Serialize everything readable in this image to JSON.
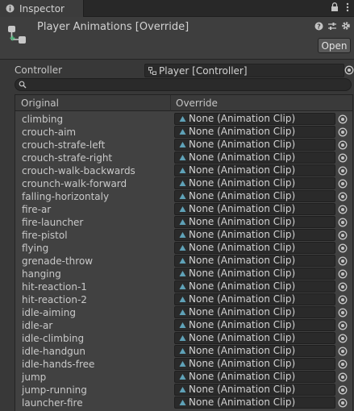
{
  "window": {
    "tab_label": "Inspector",
    "tab_icon": "info-icon",
    "tab_actions": [
      "lock-icon",
      "kebab-menu-icon"
    ]
  },
  "header": {
    "title": "Player Animations [Override]",
    "asset_icon": "animator-override-icon",
    "tools": [
      "help-icon",
      "preset-icon",
      "gear-icon"
    ],
    "open_label": "Open"
  },
  "controller": {
    "label": "Controller",
    "value": "Player [Controller]",
    "value_icon": "animator-controller-icon",
    "picker_icon": "object-picker-icon"
  },
  "search": {
    "placeholder": "",
    "icon": "search-icon"
  },
  "table": {
    "columns": [
      "Original",
      "Override"
    ],
    "clip_icon": "animation-clip-icon",
    "rows": [
      {
        "original": "climbing",
        "override": "None (Animation Clip)"
      },
      {
        "original": "crouch-aim",
        "override": "None (Animation Clip)"
      },
      {
        "original": "crouch-strafe-left",
        "override": "None (Animation Clip)"
      },
      {
        "original": "crouch-strafe-right",
        "override": "None (Animation Clip)"
      },
      {
        "original": "crouch-walk-backwards",
        "override": "None (Animation Clip)"
      },
      {
        "original": "crounch-walk-forward",
        "override": "None (Animation Clip)"
      },
      {
        "original": "falling-horizontaly",
        "override": "None (Animation Clip)"
      },
      {
        "original": "fire-ar",
        "override": "None (Animation Clip)"
      },
      {
        "original": "fire-launcher",
        "override": "None (Animation Clip)"
      },
      {
        "original": "fire-pistol",
        "override": "None (Animation Clip)"
      },
      {
        "original": "flying",
        "override": "None (Animation Clip)"
      },
      {
        "original": "grenade-throw",
        "override": "None (Animation Clip)"
      },
      {
        "original": "hanging",
        "override": "None (Animation Clip)"
      },
      {
        "original": "hit-reaction-1",
        "override": "None (Animation Clip)"
      },
      {
        "original": "hit-reaction-2",
        "override": "None (Animation Clip)"
      },
      {
        "original": "idle-aiming",
        "override": "None (Animation Clip)"
      },
      {
        "original": "idle-ar",
        "override": "None (Animation Clip)"
      },
      {
        "original": "idle-climbing",
        "override": "None (Animation Clip)"
      },
      {
        "original": "idle-handgun",
        "override": "None (Animation Clip)"
      },
      {
        "original": "idle-hands-free",
        "override": "None (Animation Clip)"
      },
      {
        "original": "jump",
        "override": "None (Animation Clip)"
      },
      {
        "original": "jump-running",
        "override": "None (Animation Clip)"
      },
      {
        "original": "launcher-fire",
        "override": "None (Animation Clip)"
      }
    ]
  },
  "colors": {
    "background": "#383838",
    "field": "#2a2a2a",
    "text": "#c4c4c4",
    "clip_icon": "#5fa2b8",
    "asset_icon_accent": "#4fb37a"
  }
}
